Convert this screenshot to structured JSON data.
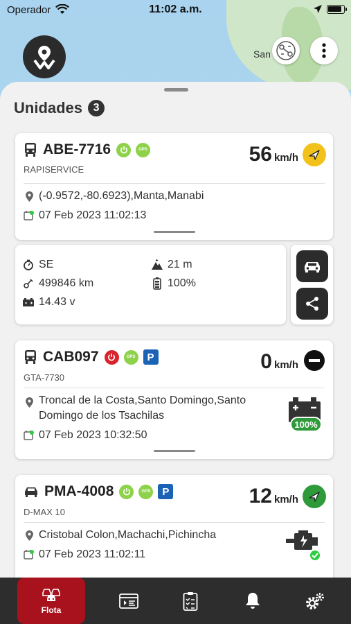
{
  "status_bar": {
    "carrier": "Operador",
    "time": "11:02 a.m."
  },
  "map": {
    "label": "San"
  },
  "sheet": {
    "title": "Unidades",
    "count": "3"
  },
  "units": [
    {
      "plate": "ABE-7716",
      "subtitle": "RAPISERVICE",
      "speed": "56",
      "speed_unit": "km/h",
      "location": "(-0.9572,-80.6923),Manta,Manabi",
      "datetime": "07 Feb 2023 11:02:13",
      "direction_color": "#f2c21b",
      "details": {
        "heading": "SE",
        "odometer": "499846 km",
        "voltage": "14.43 v",
        "altitude": "21 m",
        "battery": "100%"
      }
    },
    {
      "plate": "CAB097",
      "subtitle": "GTA-7730",
      "speed": "0",
      "speed_unit": "km/h",
      "location_line1": "Troncal de la Costa,Santo Domingo,Santo",
      "location_line2": "Domingo de los Tsachilas",
      "datetime": "07 Feb 2023 10:32:50",
      "battery_pct": "100%",
      "park": "P"
    },
    {
      "plate": "PMA-4008",
      "subtitle": "D-MAX  10",
      "speed": "12",
      "speed_unit": "km/h",
      "location": "Cristobal Colon,Machachi,Pichincha",
      "datetime": "07 Feb 2023 11:02:11",
      "direction_color": "#2e9a3a",
      "park": "P"
    }
  ],
  "gps_label": "GPS",
  "tabs": [
    {
      "label": "Flota",
      "icon": "fleet-icon"
    },
    {
      "label": "",
      "icon": "route-icon"
    },
    {
      "label": "",
      "icon": "report-icon"
    },
    {
      "label": "",
      "icon": "bell-icon"
    },
    {
      "label": "",
      "icon": "settings-icon"
    }
  ]
}
